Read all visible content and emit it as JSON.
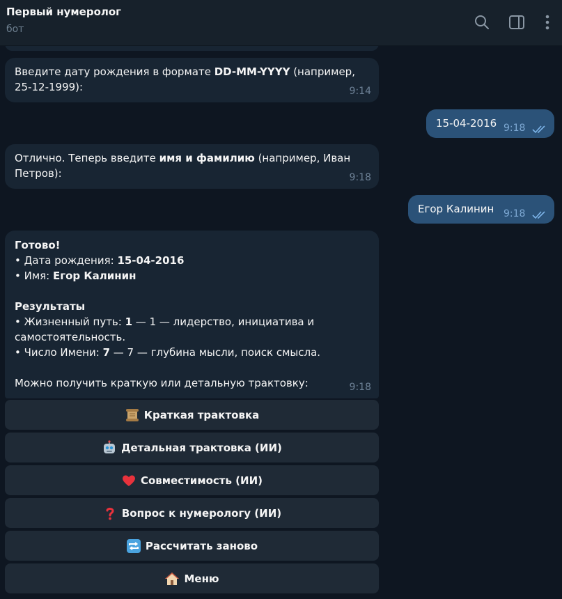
{
  "header": {
    "title": "Первый нумеролог",
    "subtitle": "бот"
  },
  "messages": [
    {
      "direction": "in",
      "line1_pre": "Введите дату рождения в формате ",
      "line1_bold": "DD-MM-YYYY",
      "line1_post": " (например,",
      "line2": "25-12-1999):",
      "time": "9:14"
    },
    {
      "direction": "out",
      "text": "15-04-2016",
      "time": "9:18"
    },
    {
      "direction": "in",
      "line1_pre": "Отлично. Теперь введите ",
      "line1_bold": "имя и фамилию",
      "line1_post": " (например, Иван",
      "line2": "Петров):",
      "time": "9:18"
    },
    {
      "direction": "out",
      "text": "Егор Калинин",
      "time": "9:18"
    },
    {
      "direction": "in",
      "ready": "Готово!",
      "dob_label": "• Дата рождения: ",
      "dob_value": "15-04-2016",
      "name_label": "• Имя: ",
      "name_value": "Егор Калинин",
      "results_heading": "Результаты",
      "life_label": "• Жизненный путь: ",
      "life_number": "1",
      "life_desc": " — 1 — лидерство, инициатива и",
      "life_desc2": "самостоятельность.",
      "name_num_label": "• Число Имени: ",
      "name_num_number": "7",
      "name_num_desc": " — 7 — глубина мысли, поиск смысла.",
      "prompt": "Можно получить краткую или детальную трактовку:",
      "time": "9:18"
    }
  ],
  "keyboard": [
    {
      "label": "Краткая трактовка",
      "icon": "scroll-icon"
    },
    {
      "label": "Детальная трактовка (ИИ)",
      "icon": "robot-icon"
    },
    {
      "label": "Совместимость (ИИ)",
      "icon": "heart-icon"
    },
    {
      "label": "Вопрос к нумерологу (ИИ)",
      "icon": "question-icon"
    },
    {
      "label": "Рассчитать заново",
      "icon": "repeat-icon"
    },
    {
      "label": "Меню",
      "icon": "house-icon"
    }
  ],
  "header_icons": [
    "search-icon",
    "sidebar-toggle-icon",
    "more-vertical-icon"
  ],
  "colors": {
    "background": "#0e1621",
    "header": "#17212b",
    "incoming_bubble": "#182533",
    "outgoing_bubble": "#2b5278",
    "keyboard_button": "#1f2a36",
    "read_ticks": "#7cb3e8"
  }
}
